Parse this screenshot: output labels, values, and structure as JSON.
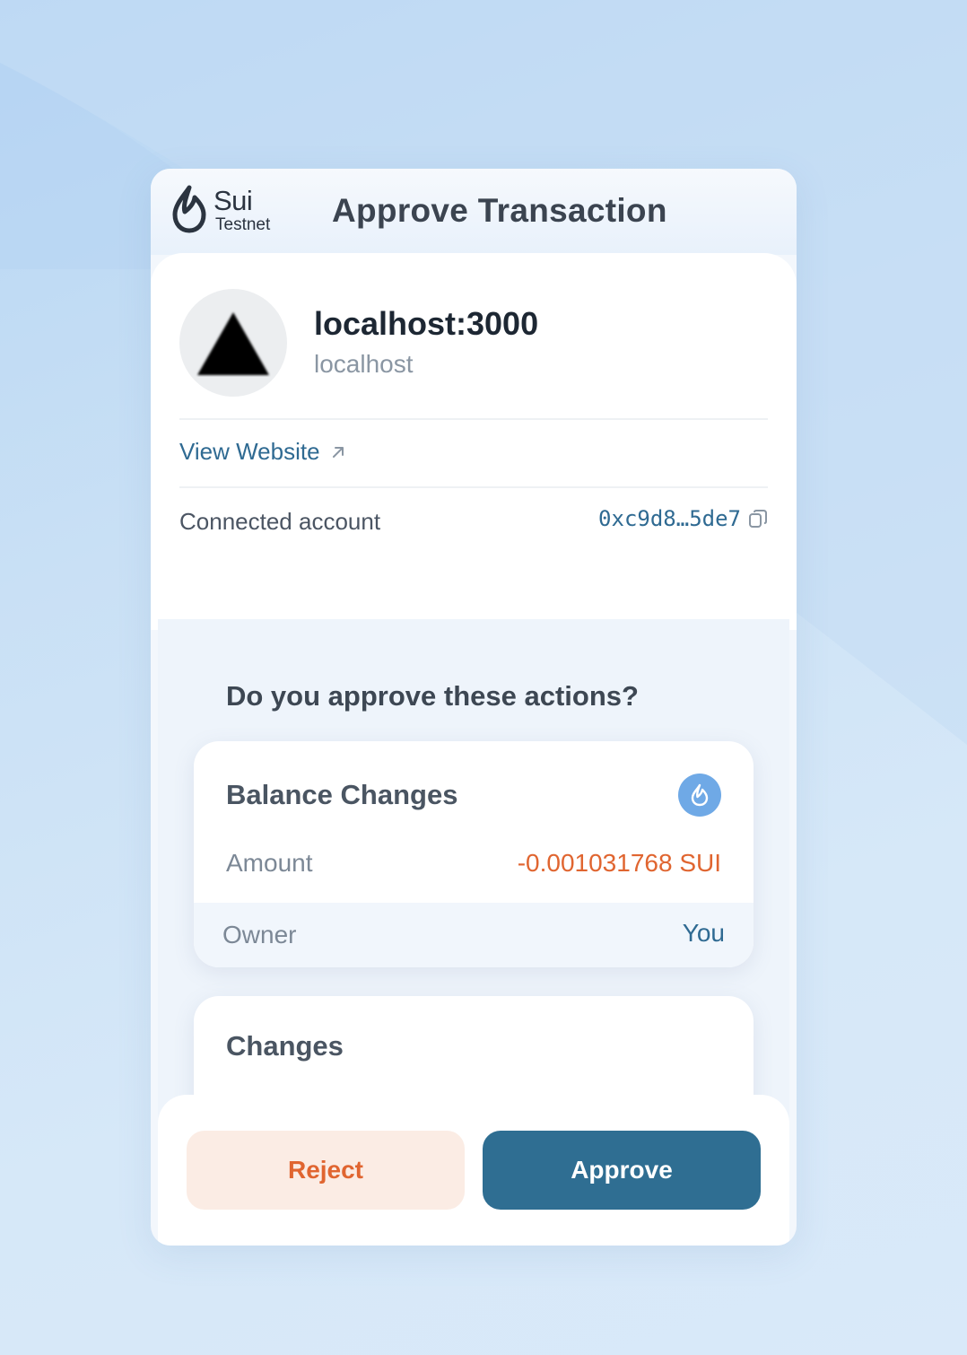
{
  "header": {
    "brand": "Sui",
    "network": "Testnet",
    "title": "Approve Transaction",
    "logo_icon": "sui-drop-icon"
  },
  "site": {
    "name": "localhost:3000",
    "host": "localhost",
    "view_link": "View Website",
    "connected_label": "Connected account",
    "connected_address": "0xc9d8…5de7"
  },
  "actions": {
    "question": "Do you approve these actions?",
    "balance_card": {
      "title": "Balance Changes",
      "amount_label": "Amount",
      "amount_value": "-0.001031768 SUI",
      "owner_label": "Owner",
      "owner_value": "You"
    },
    "changes_card": {
      "title": "Changes"
    }
  },
  "footer": {
    "reject_label": "Reject",
    "approve_label": "Approve"
  },
  "colors": {
    "accent": "#2f6e92",
    "negative": "#e06530",
    "sui_blue": "#6fa9e6"
  }
}
